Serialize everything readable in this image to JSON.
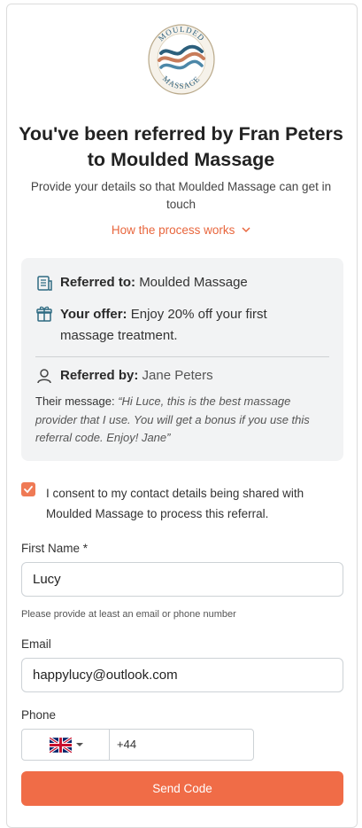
{
  "logo": {
    "text_top": "MOULDED",
    "text_bottom": "MASSAGE"
  },
  "header": {
    "title_line1": "You've been referred by Fran Peters",
    "title_line2": "to Moulded Massage",
    "subtitle": "Provide your details so that Moulded Massage can get in touch",
    "how_link": "How the process works"
  },
  "referral": {
    "referred_to_label": "Referred to:",
    "referred_to_value": "Moulded Massage",
    "offer_label": "Your offer:",
    "offer_value": "Enjoy 20% off your first",
    "offer_value2": "massage treatment.",
    "referred_by_label": "Referred by:",
    "referred_by_value": "Jane Peters",
    "message_label": "Their message:",
    "message_text": "“Hi Luce, this is the best massage provider that I use. You will get a bonus if you use this referral code. Enjoy! Jane”"
  },
  "consent": {
    "checked": true,
    "text": "I consent to my contact details being shared with Moulded Massage to process this referral."
  },
  "form": {
    "first_name_label": "First Name *",
    "first_name_value": "Lucy",
    "help_text": "Please provide at least an email or phone number",
    "email_label": "Email",
    "email_value": "happylucy@outlook.com",
    "phone_label": "Phone",
    "phone_dial": "+44",
    "send_code_label": "Send Code"
  },
  "colors": {
    "accent": "#f06c47",
    "link": "#e8663d",
    "panel": "#f2f3f4"
  }
}
